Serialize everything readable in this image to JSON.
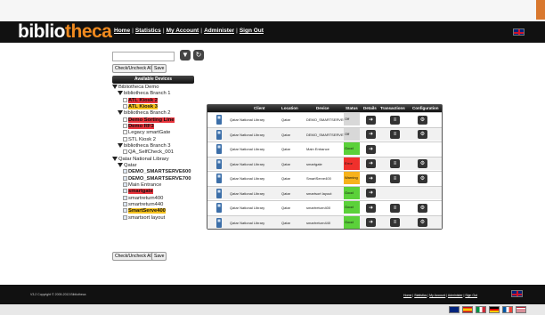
{
  "app": {
    "logo_part1": "biblio",
    "logo_part2": "theca"
  },
  "nav": {
    "items": [
      "Home",
      "Statistics",
      "My Account",
      "Administer",
      "Sign Out"
    ],
    "separator": "|"
  },
  "toolbar": {
    "check_label": "Check/Uncheck All",
    "save_label": "Save"
  },
  "devices_header": "Available Devices",
  "tree": [
    {
      "label": "Bibliotheca Demo",
      "level": 0,
      "kind": "folder"
    },
    {
      "label": "bibliotheca Branch 1",
      "level": 1,
      "kind": "folder"
    },
    {
      "label": "ATL Kiosk 2",
      "level": 2,
      "kind": "item",
      "hl": "red"
    },
    {
      "label": "ATL Kiosk 3",
      "level": 2,
      "kind": "item",
      "hl": "yel"
    },
    {
      "label": "bibliotheca Branch 2",
      "level": 1,
      "kind": "folder"
    },
    {
      "label": "Demo Sorting Line",
      "level": 2,
      "kind": "item",
      "hl": "red"
    },
    {
      "label": "Demo RF3",
      "level": 2,
      "kind": "item",
      "hl": "red"
    },
    {
      "label": "Legacy smartGate",
      "level": 2,
      "kind": "item"
    },
    {
      "label": "STL Kiosk 2",
      "level": 2,
      "kind": "item"
    },
    {
      "label": "bibliotheca Branch 3",
      "level": 1,
      "kind": "folder"
    },
    {
      "label": "QA_SelfCheck_001",
      "level": 2,
      "kind": "item"
    },
    {
      "label": "Qatar National Library",
      "level": 0,
      "kind": "folder"
    },
    {
      "label": "Qatar",
      "level": 1,
      "kind": "folder"
    },
    {
      "label": "DEMO_SMARTSERVE600",
      "level": 2,
      "kind": "item",
      "checked": true,
      "hl": "bld"
    },
    {
      "label": "DEMO_SMARTSERVE700",
      "level": 2,
      "kind": "item",
      "checked": true,
      "hl": "bld"
    },
    {
      "label": "Main Entrance",
      "level": 2,
      "kind": "item",
      "checked": true
    },
    {
      "label": "smartgate",
      "level": 2,
      "kind": "item",
      "checked": true,
      "hl": "red"
    },
    {
      "label": "smartreturn400",
      "level": 2,
      "kind": "item",
      "checked": true
    },
    {
      "label": "smartreturn440",
      "level": 2,
      "kind": "item",
      "checked": true
    },
    {
      "label": "SmartServe400",
      "level": 2,
      "kind": "item",
      "checked": true,
      "hl": "yel"
    },
    {
      "label": "smartsort layout",
      "level": 2,
      "kind": "item",
      "checked": true
    }
  ],
  "table": {
    "headers": [
      "Client",
      "Location",
      "Device",
      "Status",
      "Details",
      "Transactions",
      "Configuration"
    ],
    "rows": [
      {
        "client": "Qatar National Library",
        "location": "Qatar",
        "device": "DEMO_SMARTSERVE600",
        "status": "Off",
        "status_color": "#d8d8d8",
        "trans": true,
        "config": true
      },
      {
        "client": "Qatar National Library",
        "location": "Qatar",
        "device": "DEMO_SMARTSERVE700",
        "status": "Off",
        "status_color": "#d8d8d8",
        "trans": true,
        "config": true
      },
      {
        "client": "Qatar National Library",
        "location": "Qatar",
        "device": "Main Entrance",
        "status": "Good",
        "status_color": "#5bd13a",
        "trans": false,
        "config": false
      },
      {
        "client": "Qatar National Library",
        "location": "Qatar",
        "device": "smartgate",
        "status": "Error",
        "status_color": "#f0302c",
        "trans": true,
        "config": true
      },
      {
        "client": "Qatar National Library",
        "location": "Qatar",
        "device": "SmartServe400",
        "status": "Warning",
        "status_color": "#f7b21b",
        "trans": true,
        "config": true
      },
      {
        "client": "Qatar National Library",
        "location": "Qatar",
        "device": "smartsort layout",
        "status": "Good",
        "status_color": "#5bd13a",
        "trans": false,
        "config": false
      },
      {
        "client": "Qatar National Library",
        "location": "Qatar",
        "device": "smartreturn400",
        "status": "Good",
        "status_color": "#5bd13a",
        "trans": true,
        "config": true
      },
      {
        "client": "Qatar National Library",
        "location": "Qatar",
        "device": "smartreturn440",
        "status": "Good",
        "status_color": "#5bd13a",
        "trans": true,
        "config": true
      }
    ]
  },
  "footer": {
    "copyright": "V3.2 Copyright © 2009-2013 Bibliotheca"
  },
  "colors": {
    "brand_orange": "#f08a1f",
    "header_bg": "#111111"
  },
  "icons": {
    "filter": "filter-icon",
    "refresh": "refresh-icon",
    "details": "arrow-icon",
    "transactions": "list-icon",
    "configuration": "gear-icon"
  }
}
